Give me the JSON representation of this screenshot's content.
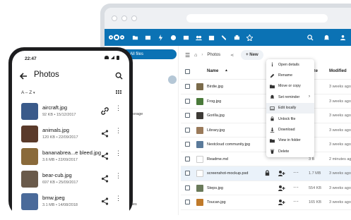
{
  "desktop": {
    "sidebar": {
      "active_label": "All files",
      "item_storage": "storage",
      "item_files": "files"
    },
    "breadcrumb": {
      "folder": "Photos",
      "new_label": "New"
    },
    "columns": {
      "name": "Name",
      "size": "ize",
      "modified": "Modified"
    },
    "rows": [
      {
        "name": "Birdie.jpg",
        "size": "",
        "modified": "3 weeks ago",
        "color": "#7a6a4a"
      },
      {
        "name": "Frog.jpg",
        "size": "KB",
        "modified": "3 weeks ago",
        "color": "#4a7a3a"
      },
      {
        "name": "Gorilla.jpg",
        "size": "KB",
        "modified": "3 weeks ago",
        "color": "#3d3a36"
      },
      {
        "name": "Library.jpg",
        "size": "KB",
        "modified": "3 weeks ago",
        "color": "#9a7a5a"
      },
      {
        "name": "Nextcloud community.jpg",
        "size": "KB",
        "modified": "3 weeks ago",
        "color": "#5a7a9a"
      },
      {
        "name": "Readme.md",
        "size": "3 B",
        "modified": "2 minutes ago",
        "color": "#ffffff"
      },
      {
        "name": "screenshot-mockup.psd",
        "size": "1.7 MB",
        "modified": "3 weeks ago",
        "color": "#ffffff"
      },
      {
        "name": "Steps.jpg",
        "size": "554 KB",
        "modified": "3 weeks ago",
        "color": "#6a7a5a"
      },
      {
        "name": "Toucan.jpg",
        "size": "165 KB",
        "modified": "3 weeks ago",
        "color": "#c07a2a"
      }
    ],
    "context_menu": [
      {
        "label": "Open details",
        "icon": "info-icon"
      },
      {
        "label": "Rename",
        "icon": "pencil-icon"
      },
      {
        "label": "Move or copy",
        "icon": "folder-move-icon"
      },
      {
        "label": "Set reminder",
        "icon": "bell-icon",
        "submenu": true
      },
      {
        "label": "Edit locally",
        "icon": "laptop-icon"
      },
      {
        "label": "Unlock file",
        "icon": "lock-icon"
      },
      {
        "label": "Download",
        "icon": "download-icon"
      },
      {
        "label": "View in folder",
        "icon": "folder-icon"
      },
      {
        "label": "Delete",
        "icon": "trash-icon"
      }
    ]
  },
  "phone": {
    "time": "22:47",
    "title": "Photos",
    "sort": "A – Z",
    "items": [
      {
        "name": "aircraft.jpg",
        "meta": "92 KB • 15/12/2017",
        "action": "link-icon",
        "color": "#3a5a8a"
      },
      {
        "name": "animals.jpg",
        "meta": "120 KB • 22/09/2017",
        "action": "share-icon",
        "color": "#5a3a2a"
      },
      {
        "name": "bananabrea...e bleed.jpg",
        "meta": "3.6 MB • 22/09/2017",
        "action": "share-icon",
        "color": "#8a6a3a"
      },
      {
        "name": "bear-cub.jpg",
        "meta": "697 KB • 25/09/2017",
        "action": "share-icon",
        "color": "#6a5a4a"
      },
      {
        "name": "bmw.jpeg",
        "meta": "3.1 MB • 14/08/2018",
        "action": "share-icon",
        "color": "#4a6a9a"
      }
    ]
  },
  "colors": {
    "brand": "#0b72b4",
    "phone_frame": "#1d1d1f"
  }
}
